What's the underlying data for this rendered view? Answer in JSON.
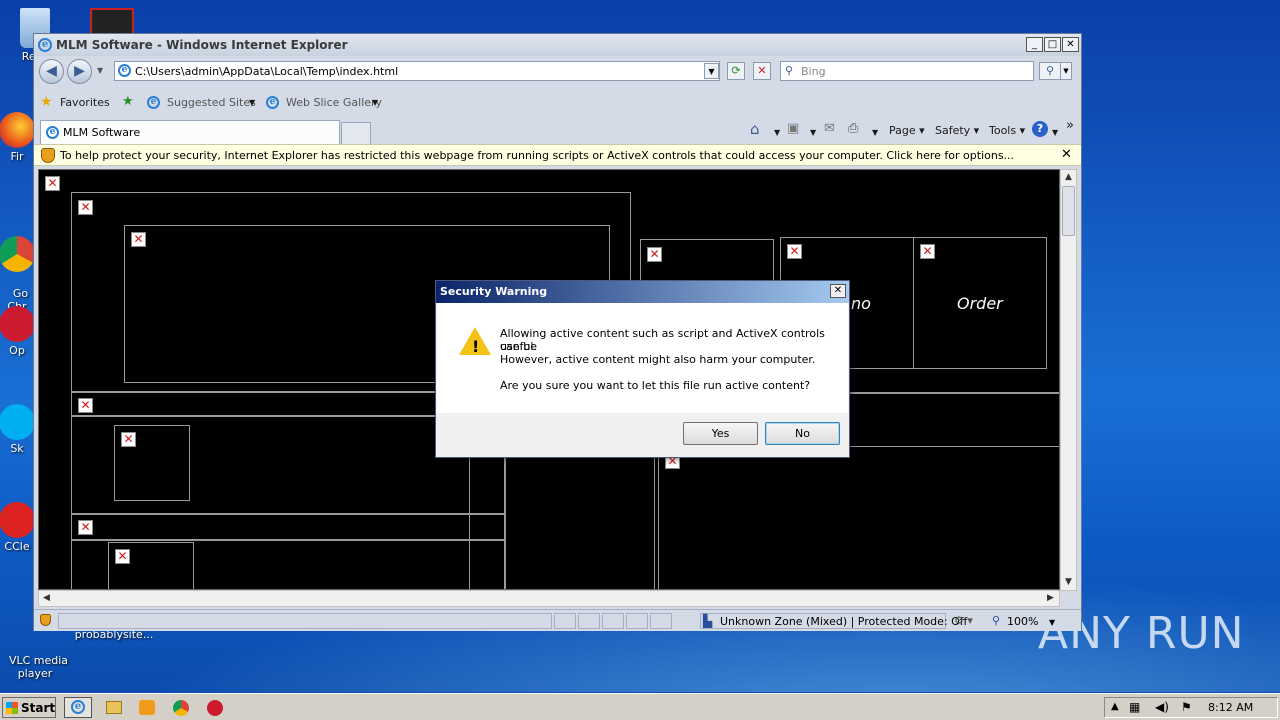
{
  "desktop": {
    "icons": [
      {
        "label": "Recy"
      },
      {
        "label": "Fir"
      },
      {
        "label": "Go\nChr"
      },
      {
        "label": "Op"
      },
      {
        "label": "Sk"
      },
      {
        "label": "CCle"
      },
      {
        "label": "VLC media\nplayer"
      },
      {
        "label": "probablysite..."
      }
    ],
    "watermark": "ANY RUN"
  },
  "ie": {
    "title": "MLM Software - Windows Internet Explorer",
    "address": "C:\\Users\\admin\\AppData\\Local\\Temp\\index.html",
    "search_placeholder": "Bing",
    "favorites_label": "Favorites",
    "suggested_sites": "Suggested Sites",
    "web_slice_gallery": "Web Slice Gallery",
    "tab_title": "MLM Software",
    "cmd_page": "Page",
    "cmd_safety": "Safety",
    "cmd_tools": "Tools",
    "infobar_text": "To help protect your security, Internet Explorer has restricted this webpage from running scripts or ActiveX controls that could access your computer. Click here for options...",
    "page_tiles": {
      "partial_label": "no",
      "order_label": "Order"
    },
    "status_zone": "Unknown Zone (Mixed) | Protected Mode: Off",
    "zoom": "100%"
  },
  "dialog": {
    "title": "Security Warning",
    "line1": "Allowing active content such as script and ActiveX controls can be",
    "line2": "useful.",
    "line3": "However, active content might also harm your computer.",
    "line4": "Are you sure you want to let this file run active content?",
    "yes_label": "Yes",
    "no_label": "No"
  },
  "taskbar": {
    "start_label": "Start",
    "clock": "8:12 AM"
  },
  "colors": {
    "dialog_title_start": "#0a246a",
    "dialog_title_end": "#a6caf0",
    "infobar_bg": "#ffffe1",
    "page_bg": "#000000"
  }
}
